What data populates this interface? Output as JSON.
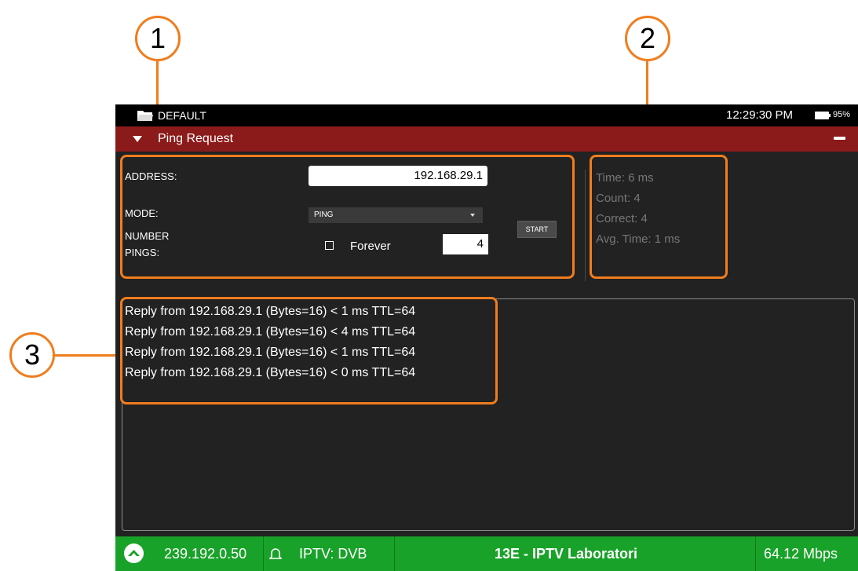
{
  "topbar": {
    "profile": "DEFAULT",
    "time": "12:29:30 PM",
    "battery": "95%"
  },
  "panel": {
    "title": "Ping Request"
  },
  "form": {
    "address_label": "ADDRESS:",
    "address_value": "192.168.29.1",
    "mode_label": "MODE:",
    "mode_value": "PING",
    "pings_label_line1": "NUMBER",
    "pings_label_line2": "PINGS:",
    "forever_label": "Forever",
    "forever_checked": false,
    "pings_value": "4",
    "start_label": "START"
  },
  "stats": {
    "time": "Time: 6 ms",
    "count": "Count: 4",
    "correct": "Correct: 4",
    "avg_time": "Avg. Time: 1 ms"
  },
  "log": [
    "Reply from 192.168.29.1 (Bytes=16) < 1 ms TTL=64",
    "Reply from 192.168.29.1 (Bytes=16) < 4 ms TTL=64",
    "Reply from 192.168.29.1 (Bytes=16) < 1 ms TTL=64",
    "Reply from 192.168.29.1 (Bytes=16) < 0 ms TTL=64"
  ],
  "statusbar": {
    "multicast": "239.192.0.50",
    "service": "IPTV: DVB",
    "channel": "13E - IPTV Laboratori",
    "bitrate": "64.12 Mbps"
  },
  "callouts": [
    "1",
    "2",
    "3"
  ],
  "colors": {
    "title_bar": "#8b1a1a",
    "status_bar": "#19a229",
    "callout": "#f07d1e",
    "background": "#222222"
  }
}
